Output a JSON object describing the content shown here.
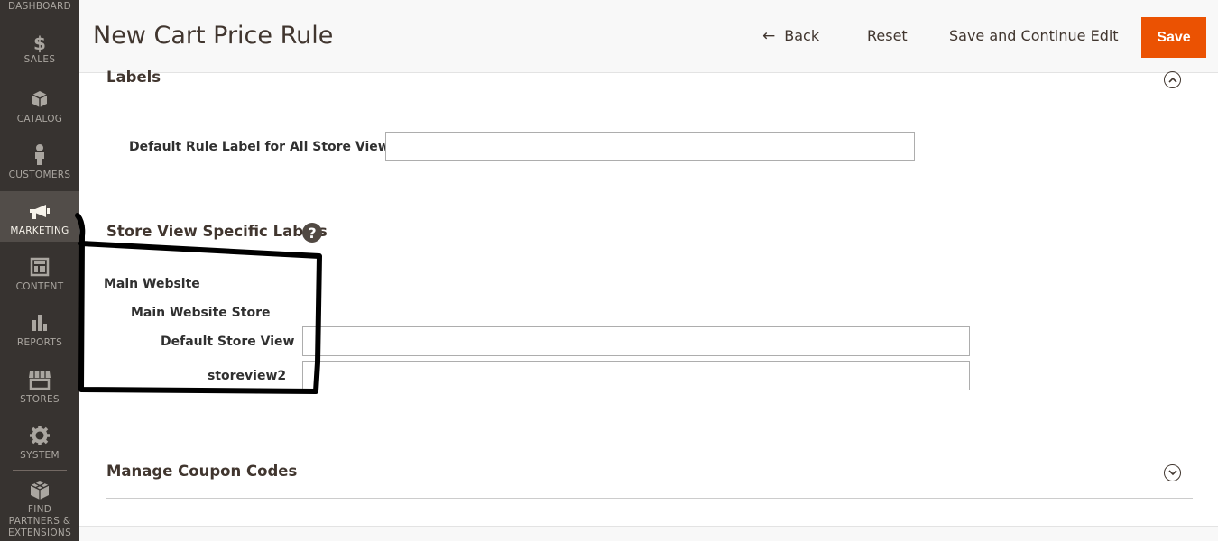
{
  "sidebar": {
    "items": [
      {
        "label": "DASHBOARD",
        "icon": "dashboard-icon"
      },
      {
        "label": "SALES",
        "icon": "dollar-icon"
      },
      {
        "label": "CATALOG",
        "icon": "box-icon"
      },
      {
        "label": "CUSTOMERS",
        "icon": "person-icon"
      },
      {
        "label": "MARKETING",
        "icon": "megaphone-icon",
        "active": true
      },
      {
        "label": "CONTENT",
        "icon": "layout-icon"
      },
      {
        "label": "REPORTS",
        "icon": "bar-chart-icon"
      },
      {
        "label": "STORES",
        "icon": "store-icon"
      },
      {
        "label": "SYSTEM",
        "icon": "gear-icon"
      },
      {
        "label": "FIND PARTNERS & EXTENSIONS",
        "label_lines": [
          "FIND",
          "PARTNERS &",
          "EXTENSIONS"
        ],
        "icon": "cubes-icon"
      }
    ]
  },
  "header": {
    "title": "New Cart Price Rule",
    "back_label": "Back",
    "reset_label": "Reset",
    "save_continue_label": "Save and Continue Edit",
    "save_label": "Save"
  },
  "labels_section": {
    "title": "Labels",
    "default_label": "Default Rule Label for All Store Views",
    "default_value": ""
  },
  "store_view_section": {
    "title": "Store View Specific Labels",
    "website": "Main Website",
    "store": "Main Website Store",
    "views": [
      {
        "label": "Default Store View",
        "value": ""
      },
      {
        "label": "storeview2",
        "value": ""
      }
    ]
  },
  "coupon_section": {
    "title": "Manage Coupon Codes"
  },
  "colors": {
    "accent": "#eb5202",
    "sidebar_bg": "#373330",
    "sidebar_active": "#524d49"
  }
}
